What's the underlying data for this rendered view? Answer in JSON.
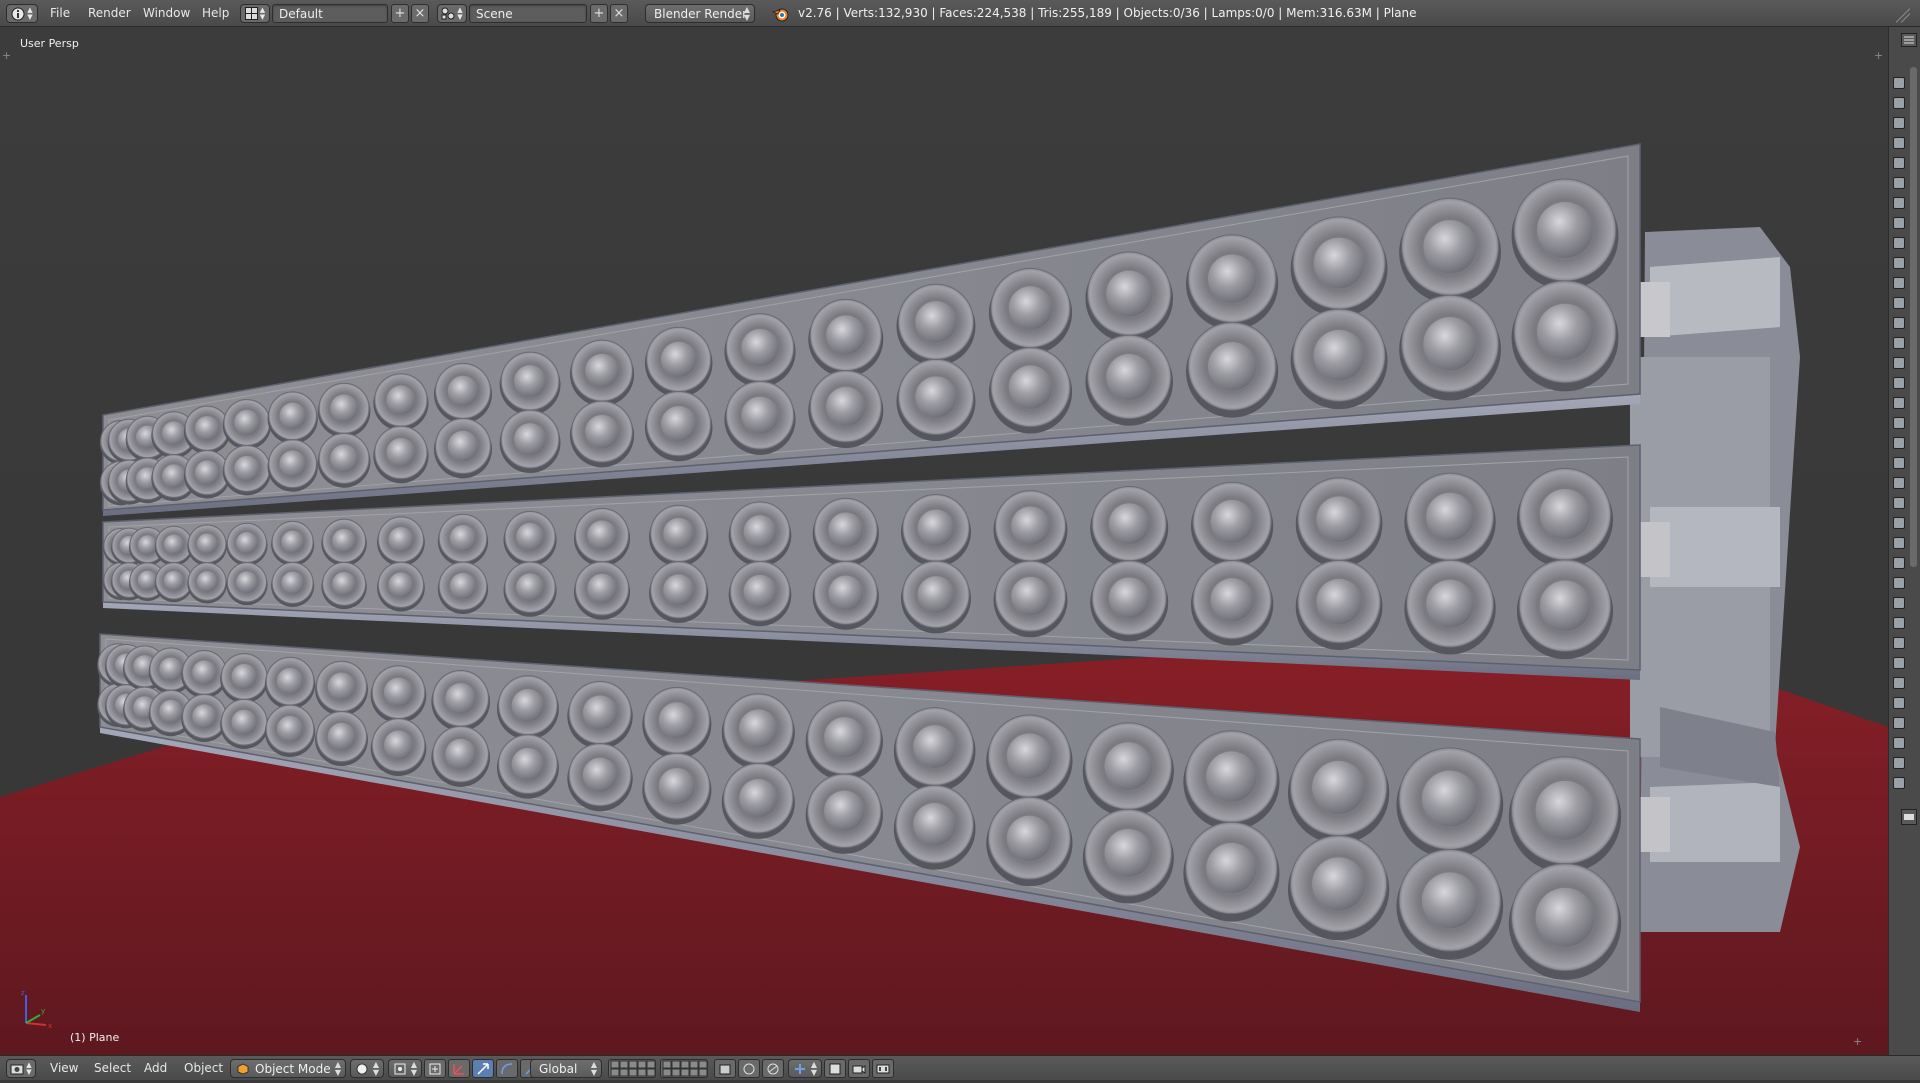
{
  "header": {
    "menus": [
      "File",
      "Render",
      "Window",
      "Help"
    ],
    "screen_layout": "Default",
    "scene": "Scene",
    "render_engine": "Blender Render",
    "stats": "v2.76 | Verts:132,930 | Faces:224,538 | Tris:255,189 | Objects:0/36 | Lamps:0/0 | Mem:316.63M | Plane",
    "add_symbol": "+",
    "close_symbol": "×"
  },
  "viewport": {
    "view_name": "User Persp",
    "active_object": "(1) Plane",
    "colors": {
      "background": "#3a3a3a",
      "floor": "#6e1c22",
      "mesh": "#8c8c8c",
      "mesh_shadow": "#7a7c88"
    }
  },
  "footer": {
    "menus": [
      "View",
      "Select",
      "Add",
      "Object"
    ],
    "mode": "Object Mode",
    "orientation": "Global"
  }
}
